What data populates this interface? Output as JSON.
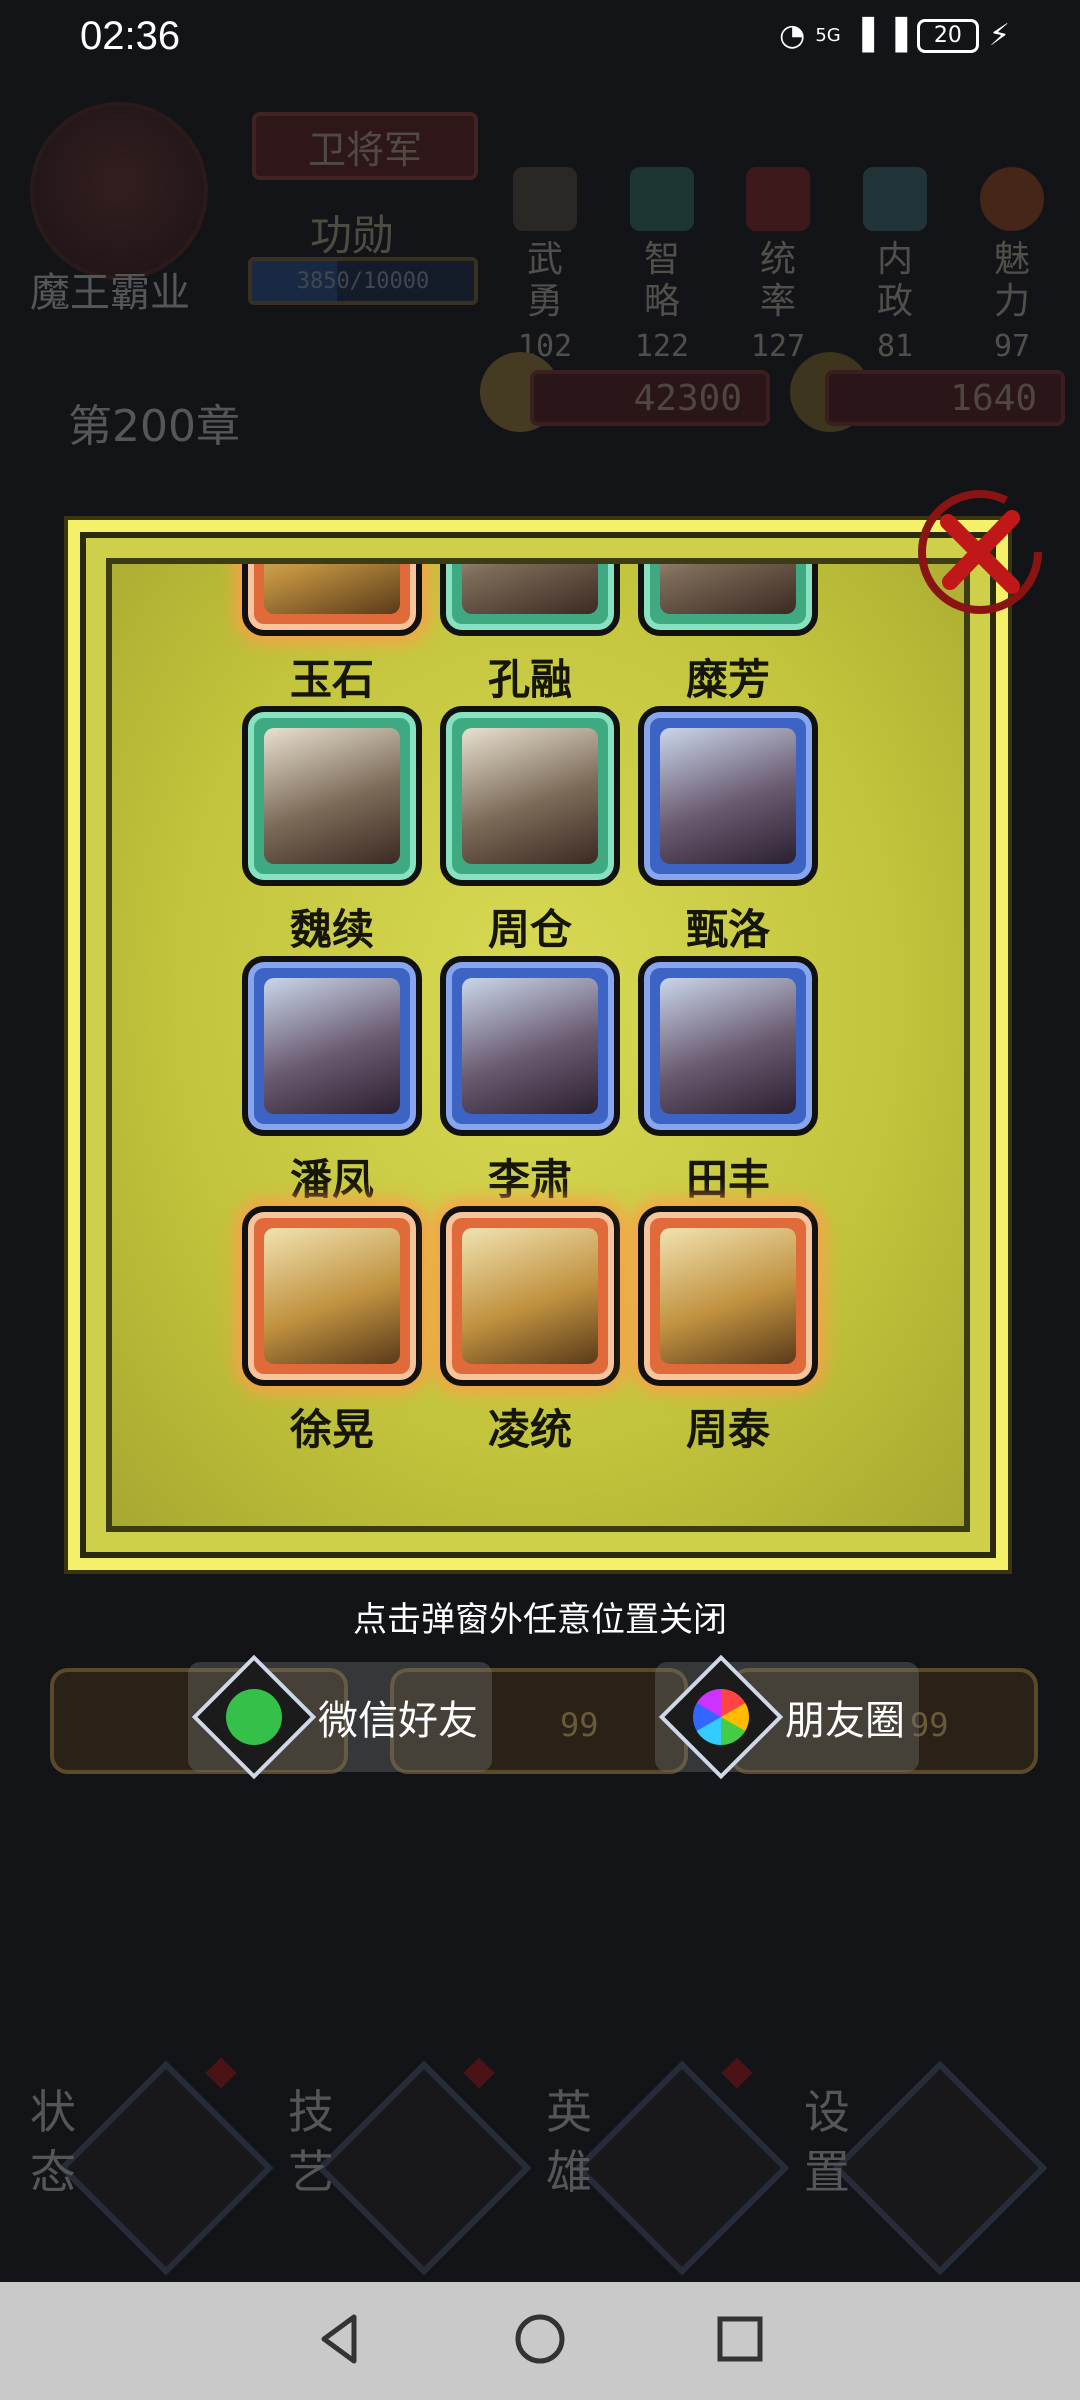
{
  "status_bar": {
    "time": "02:36",
    "network": "5G",
    "battery": "20"
  },
  "background": {
    "player_name": "魔王霸业",
    "rank": "卫将军",
    "merit_label": "功勋",
    "merit_text": "3850/10000",
    "merit_progress": 0.385,
    "stats": [
      {
        "label_top": "武",
        "label_bottom": "勇",
        "value": "102",
        "icon": "spear-icon"
      },
      {
        "label_top": "智",
        "label_bottom": "略",
        "value": "122",
        "icon": "fan-icon"
      },
      {
        "label_top": "统",
        "label_bottom": "率",
        "value": "127",
        "icon": "token-icon"
      },
      {
        "label_top": "内",
        "label_bottom": "政",
        "value": "81",
        "icon": "seal-icon"
      },
      {
        "label_top": "魅",
        "label_bottom": "力",
        "value": "97",
        "icon": "ornament-icon"
      }
    ],
    "chapter": "第200章",
    "coins": "42300",
    "grain": "1640",
    "nav": [
      {
        "top": "状",
        "bottom": "态",
        "icon": "dragon-icon"
      },
      {
        "top": "技",
        "bottom": "艺",
        "icon": "leaf-icon"
      },
      {
        "top": "英",
        "bottom": "雄",
        "icon": "helmet-icon"
      },
      {
        "top": "设",
        "bottom": "置",
        "icon": "gear-icon"
      }
    ]
  },
  "modal": {
    "heroes": [
      {
        "name": "玉石",
        "tier": "orange"
      },
      {
        "name": "孔融",
        "tier": "green"
      },
      {
        "name": "糜芳",
        "tier": "green"
      },
      {
        "name": "魏续",
        "tier": "green"
      },
      {
        "name": "周仓",
        "tier": "green"
      },
      {
        "name": "甄洛",
        "tier": "blue"
      },
      {
        "name": "潘凤",
        "tier": "blue"
      },
      {
        "name": "李肃",
        "tier": "blue"
      },
      {
        "name": "田丰",
        "tier": "blue"
      },
      {
        "name": "徐晃",
        "tier": "orange"
      },
      {
        "name": "凌统",
        "tier": "orange"
      },
      {
        "name": "周泰",
        "tier": "orange"
      }
    ],
    "hint": "点击弹窗外任意位置关闭"
  },
  "share": {
    "wechat_friends": "微信好友",
    "moments": "朋友圈",
    "slot_counts": [
      "99",
      "99"
    ]
  },
  "colors": {
    "modal_yellow": "#cfd04a",
    "green_frame": "#3fa982",
    "blue_frame": "#3d63c4",
    "orange_frame": "#e06a3a"
  }
}
